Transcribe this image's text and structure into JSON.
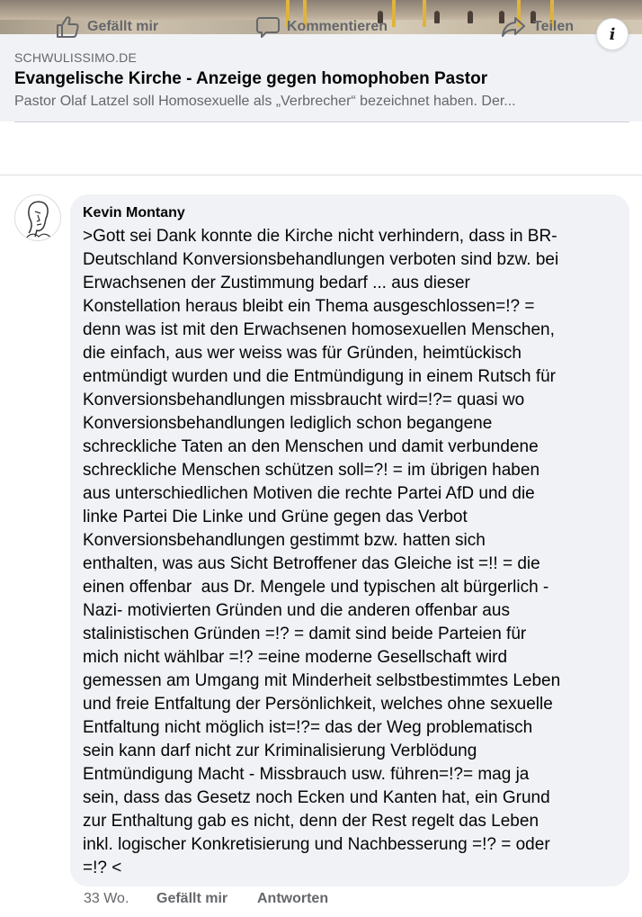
{
  "link_preview": {
    "domain": "SCHWULISSIMO.DE",
    "title": "Evangelische Kirche - Anzeige gegen homophoben Pastor",
    "description": "Pastor Olaf Latzel soll Homosexuelle als „Verbrecher“ bezeichnet haben. Der..."
  },
  "info_button": {
    "label": "i"
  },
  "actions": {
    "like": "Gefällt mir",
    "comment": "Kommentieren",
    "share": "Teilen"
  },
  "comment": {
    "author": "Kevin Montany",
    "lines": [
      ">Gott sei Dank konnte die Kirche nicht verhindern, dass in BR-",
      "Deutschland Konversionsbehandlungen verboten sind bzw. bei",
      "Erwachsenen der Zustimmung bedarf ... aus dieser",
      "Konstellation heraus bleibt ein Thema ausgeschlossen=!? =",
      "denn was ist mit den Erwachsenen homosexuellen Menschen,",
      "die einfach, aus wer weiss was für Gründen, heimtückisch",
      "entmündigt wurden und die Entmündigung in einem Rutsch für",
      "Konversionsbehandlungen missbraucht wird=!?= quasi wo",
      "Konversionsbehandlungen lediglich schon begangene",
      "schreckliche Taten an den Menschen und damit verbundene",
      "schreckliche Menschen schützen soll=?! = im übrigen haben",
      "aus unterschiedlichen Motiven die rechte Partei AfD und die",
      "linke Partei Die Linke und Grüne gegen das Verbot",
      "Konversionsbehandlungen gestimmt bzw. hatten sich",
      "enthalten, was aus Sicht Betroffener das Gleiche ist =!! = die",
      "einen offenbar  aus Dr. Mengele und typischen alt bürgerlich -",
      "Nazi- motivierten Gründen und die anderen offenbar aus",
      "stalinistischen Gründen =!? = damit sind beide Parteien für",
      "mich nicht wählbar =!? =eine moderne Gesellschaft wird",
      "gemessen am Umgang mit Minderheit selbstbestimmtes Leben",
      "und freie Entfaltung der Persönlichkeit, welches ohne sexuelle",
      "Entfaltung nicht möglich ist=!?= das der Weg problematisch",
      "sein kann darf nicht zur Kriminalisierung Verblödung",
      "Entmündigung Macht - Missbrauch usw. führen=!?= mag ja",
      "sein, dass das Gesetz noch Ecken und Kanten hat, ein Grund",
      "zur Enthaltung gab es nicht, denn der Rest regelt das Leben",
      "inkl. logischer Konkretisierung und Nachbesserung =!? = oder",
      "=!? <"
    ],
    "time": "33 Wo.",
    "like_label": "Gefällt mir",
    "reply_label": "Antworten"
  },
  "colors": {
    "card_bg": "#f0f2f5",
    "secondary_text": "#65676b",
    "primary_text": "#050505",
    "divider": "#ced0d4"
  }
}
